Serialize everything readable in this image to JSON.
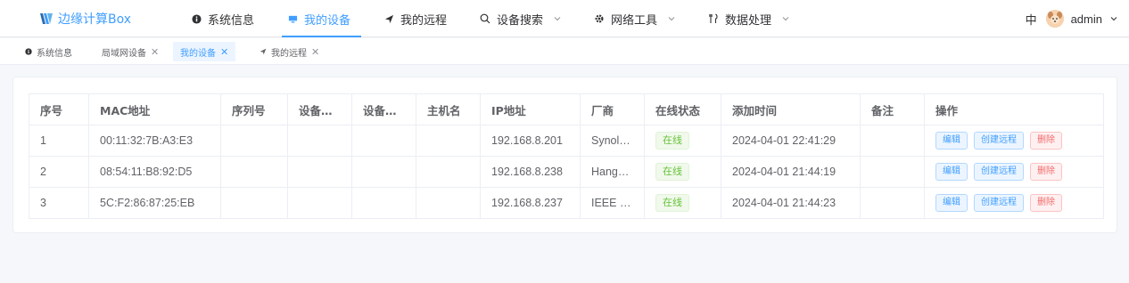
{
  "brand": {
    "title": "边缘计算Box"
  },
  "nav": {
    "items": [
      {
        "label": "系统信息",
        "icon": "info-circle-icon"
      },
      {
        "label": "我的设备",
        "icon": "monitor-icon",
        "active": true
      },
      {
        "label": "我的远程",
        "icon": "send-icon"
      },
      {
        "label": "设备搜索",
        "icon": "search-icon",
        "dropdown": true
      },
      {
        "label": "网络工具",
        "icon": "gear-icon",
        "dropdown": true
      },
      {
        "label": "数据处理",
        "icon": "fork-icon",
        "dropdown": true
      }
    ],
    "lang": "中",
    "user": "admin"
  },
  "tags": [
    {
      "label": "系统信息",
      "closable": false
    },
    {
      "label": "局域网设备",
      "closable": true
    },
    {
      "label": "我的设备",
      "closable": true,
      "active": true
    },
    {
      "label": "我的远程",
      "closable": true
    }
  ],
  "table": {
    "columns": [
      "序号",
      "MAC地址",
      "序列号",
      "设备类型",
      "设备型号",
      "主机名",
      "IP地址",
      "厂商",
      "在线状态",
      "添加时间",
      "备注",
      "操作"
    ],
    "rows": [
      {
        "no": "1",
        "mac": "00:11:32:7B:A3:E3",
        "serial": "",
        "type": "",
        "model": "",
        "host": "",
        "ip": "192.168.8.201",
        "vendor": "Synolo…",
        "status": "在线",
        "added": "2024-04-01 22:41:29",
        "note": ""
      },
      {
        "no": "2",
        "mac": "08:54:11:B8:92:D5",
        "serial": "",
        "type": "",
        "model": "",
        "host": "",
        "ip": "192.168.8.238",
        "vendor": "Hangz…",
        "status": "在线",
        "added": "2024-04-01 21:44:19",
        "note": ""
      },
      {
        "no": "3",
        "mac": "5C:F2:86:87:25:EB",
        "serial": "",
        "type": "",
        "model": "",
        "host": "",
        "ip": "192.168.8.237",
        "vendor": "IEEE …",
        "status": "在线",
        "added": "2024-04-01 21:44:23",
        "note": ""
      }
    ],
    "actions": {
      "edit": "编辑",
      "remote": "创建远程",
      "delete": "删除"
    }
  },
  "colors": {
    "accent": "#409eff",
    "success": "#67c23a",
    "danger": "#f56c6c"
  }
}
